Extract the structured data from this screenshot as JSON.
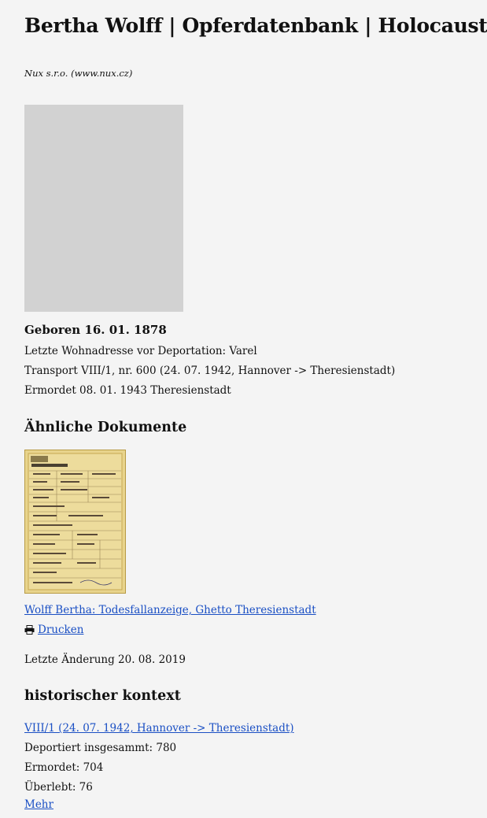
{
  "header": {
    "title": "Bertha Wolff | Opferdatenbank | Holocaust",
    "source": "Nux s.r.o. (www.nux.cz)"
  },
  "person": {
    "born": "Geboren 16. 01. 1878",
    "address": "Letzte Wohnadresse vor Deportation: Varel",
    "transport": "Transport VIII/1, nr. 600 (24. 07. 1942, Hannover -> Theresienstadt)",
    "murdered": "Ermordet 08. 01. 1943 Theresienstadt"
  },
  "similar_documents": {
    "heading": "Ähnliche Dokumente",
    "document_link": "Wolff Bertha: Todesfallanzeige, Ghetto Theresienstadt",
    "print_label": "Drucken"
  },
  "last_change": "Letzte Änderung 20. 08. 2019",
  "historical_context": {
    "heading": "historischer kontext",
    "transport_link": "VIII/1 (24. 07. 1942, Hannover -> Theresienstadt)",
    "deported": "Deportiert insgesammt: 780",
    "murdered": "Ermordet: 704",
    "survived": "Überlebt: 76",
    "more_link": "Mehr"
  },
  "colors": {
    "background": "#f4f4f4",
    "link": "#1a4fc4",
    "photo_placeholder": "#d2d2d2",
    "document_paper": "#e6d28a"
  }
}
